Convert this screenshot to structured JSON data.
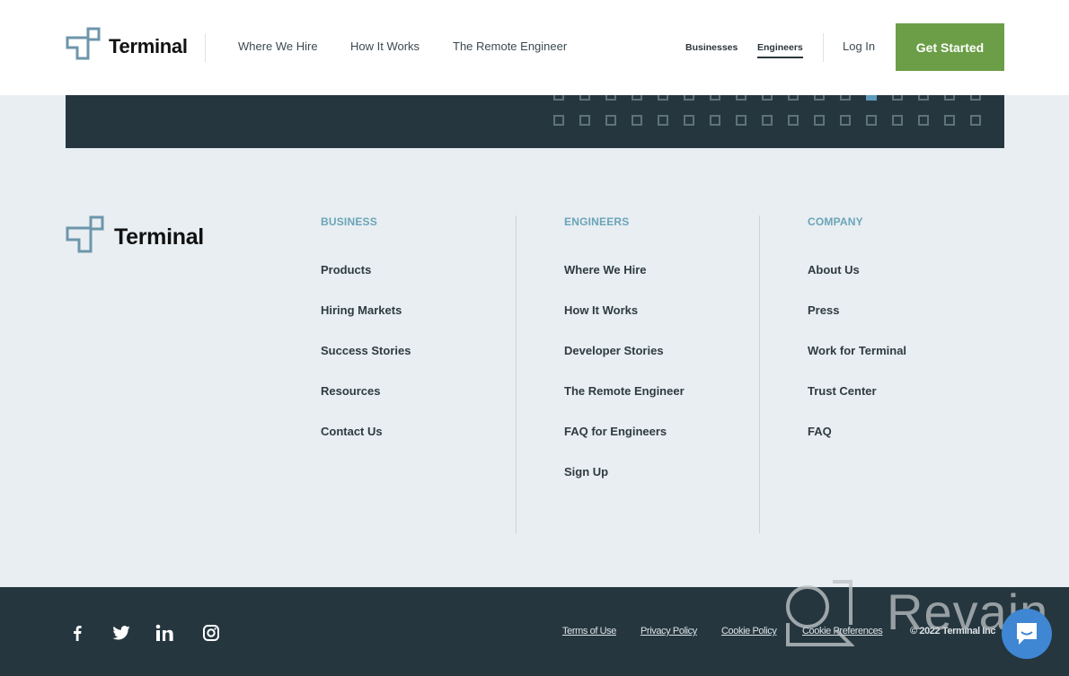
{
  "header": {
    "brand": "Terminal",
    "nav": [
      "Where We Hire",
      "How It Works",
      "The Remote Engineer"
    ],
    "segments": [
      {
        "label": "Businesses",
        "active": false
      },
      {
        "label": "Engineers",
        "active": true
      }
    ],
    "login_label": "Log In",
    "cta_label": "Get Started"
  },
  "banner": {
    "grid_columns": 17,
    "highlighted_cell": {
      "row": 1,
      "column": 13
    }
  },
  "footer": {
    "brand": "Terminal",
    "columns": [
      {
        "heading": "BUSINESS",
        "links": [
          "Products",
          "Hiring Markets",
          "Success Stories",
          "Resources",
          "Contact Us"
        ]
      },
      {
        "heading": "ENGINEERS",
        "links": [
          "Where We Hire",
          "How It Works",
          "Developer Stories",
          "The Remote Engineer",
          "FAQ for Engineers",
          "Sign Up"
        ]
      },
      {
        "heading": "COMPANY",
        "links": [
          "About Us",
          "Press",
          "Work for Terminal",
          "Trust Center",
          "FAQ"
        ]
      }
    ]
  },
  "bottom_bar": {
    "social": [
      "facebook-icon",
      "twitter-icon",
      "linkedin-icon",
      "instagram-icon"
    ],
    "legal_links": [
      "Terms of Use",
      "Privacy Policy",
      "Cookie Policy",
      "Cookie Preferences"
    ],
    "copyright": "© 2022 Terminal Inc"
  },
  "overlay": {
    "watermark": "Revain"
  },
  "colors": {
    "accent_green": "#6b9e47",
    "dark_navy": "#25363f",
    "heading_teal": "#6aa4b8",
    "page_bg": "#e8eef2",
    "chat_blue": "#3f86d3"
  }
}
